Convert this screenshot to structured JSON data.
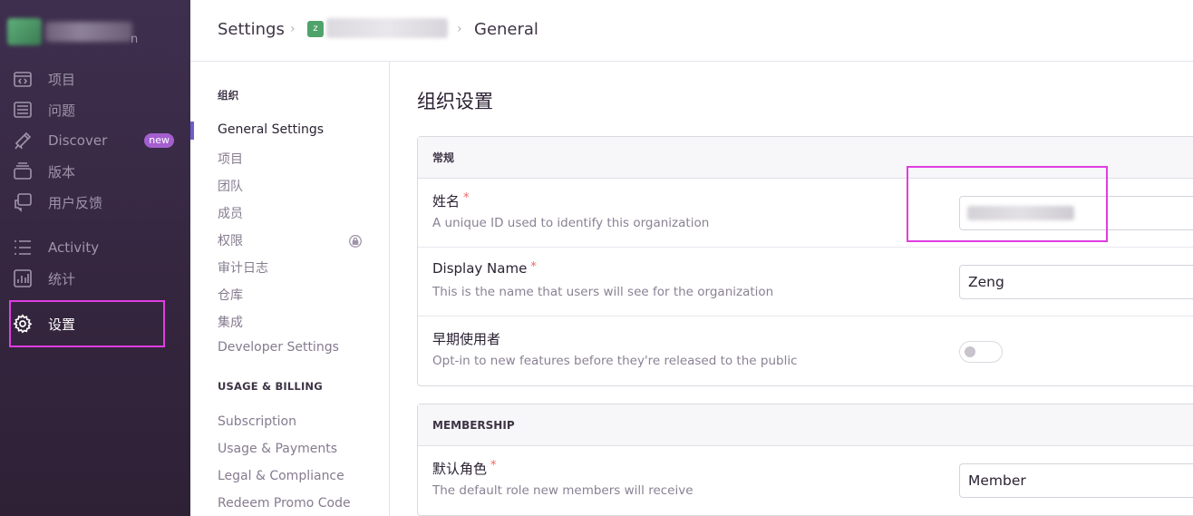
{
  "sidebar": {
    "org": {
      "name_suffix": "n"
    },
    "items": [
      {
        "label": "项目",
        "icon": "projects-icon"
      },
      {
        "label": "问题",
        "icon": "issues-icon"
      },
      {
        "label": "Discover",
        "icon": "discover-icon",
        "badge": "new"
      },
      {
        "label": "版本",
        "icon": "releases-icon"
      },
      {
        "label": "用户反馈",
        "icon": "feedback-icon"
      },
      {
        "label": "Activity",
        "icon": "activity-icon"
      },
      {
        "label": "统计",
        "icon": "stats-icon"
      },
      {
        "label": "设置",
        "icon": "gear-icon",
        "active": true
      }
    ]
  },
  "breadcrumb": {
    "root": "Settings",
    "org_initial": "z",
    "current": "General"
  },
  "subnav": {
    "org_heading": "组织",
    "org_items": [
      "General Settings",
      "项目",
      "团队",
      "成员",
      "权限",
      "审计日志",
      "仓库",
      "集成",
      "Developer Settings"
    ],
    "billing_heading": "USAGE & BILLING",
    "billing_items": [
      "Subscription",
      "Usage & Payments",
      "Legal & Compliance",
      "Redeem Promo Code"
    ]
  },
  "main": {
    "title": "组织设置",
    "general_panel": {
      "heading": "常规",
      "rows": [
        {
          "label": "姓名",
          "required": "*",
          "help": "A unique ID used to identify this organization",
          "value": ""
        },
        {
          "label": "Display Name",
          "required": "*",
          "help": "This is the name that users will see for the organization",
          "value": "Zeng"
        },
        {
          "label": "早期使用者",
          "help": "Opt-in to new features before they're released to the public",
          "toggle_on": false
        }
      ]
    },
    "membership_panel": {
      "heading": "MEMBERSHIP",
      "rows": [
        {
          "label": "默认角色",
          "required": "*",
          "help": "The default role new members will receive",
          "value": "Member"
        }
      ]
    }
  },
  "colors": {
    "sidebar_bg": "#3e2f4f",
    "active_marker": "#6c5fc7",
    "highlight_annotation": "#e03de3",
    "badge_new": "#a45fcf",
    "required_star": "#f0655e"
  }
}
